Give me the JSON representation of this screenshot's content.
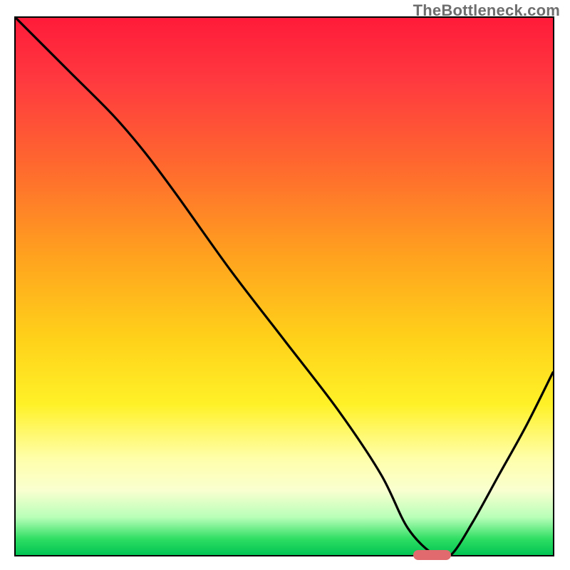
{
  "watermark": "TheBottleneck.com",
  "chart_data": {
    "type": "line",
    "title": "",
    "xlabel": "",
    "ylabel": "",
    "xlim": [
      0,
      100
    ],
    "ylim": [
      0,
      100
    ],
    "grid": false,
    "legend": false,
    "background": "gradient_red_to_green",
    "marker": {
      "x_range": [
        74,
        81
      ],
      "y": 0,
      "color": "#e06a6e"
    },
    "series": [
      {
        "name": "bottleneck-curve",
        "color": "#000000",
        "x": [
          0,
          10,
          18,
          24,
          30,
          40,
          50,
          60,
          68,
          73,
          78,
          81,
          85,
          90,
          95,
          100
        ],
        "y": [
          100,
          90,
          82,
          75,
          67,
          53,
          40,
          27,
          15,
          5,
          0,
          0,
          6,
          15,
          24,
          34
        ]
      }
    ]
  }
}
